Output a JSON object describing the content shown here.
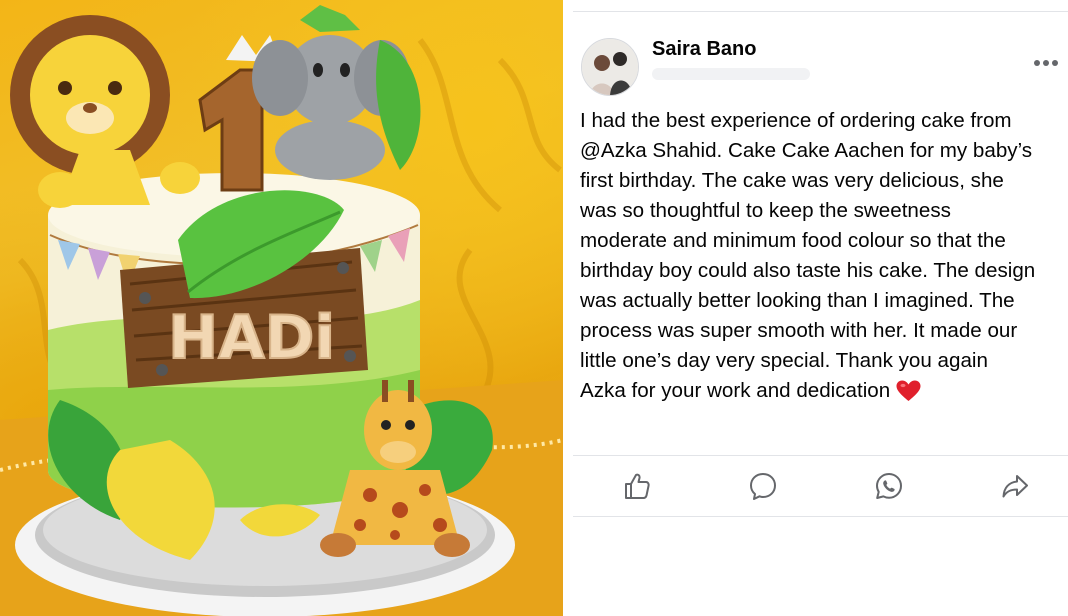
{
  "photo": {
    "description_icon": "cake-photo",
    "cake_name_topper": "HADi",
    "number_topper": "1"
  },
  "post": {
    "author": "Saira Bano",
    "avatar_icon": "profile-avatar",
    "more_icon": "more-options-icon",
    "body_lines": [
      "I had the best experience of ordering cake from",
      "@Azka Shahid. Cake Cake Aachen for my baby’s",
      "first birthday. The cake was very delicious, she",
      "was so thoughtful to keep the sweetness",
      "moderate and minimum food colour so that the",
      "birthday boy could also taste his cake. The design",
      "was actually better looking than I imagined. The",
      "process was super smooth with her. It made our",
      "little one’s day very special. Thank you again",
      "Azka for your work and dedication"
    ],
    "heart_emoji_color": "#e0202c",
    "actions": [
      {
        "name": "like",
        "icon": "thumbs-up-icon"
      },
      {
        "name": "comment",
        "icon": "comment-bubble-icon"
      },
      {
        "name": "whatsapp",
        "icon": "whatsapp-icon"
      },
      {
        "name": "share",
        "icon": "share-arrow-icon"
      }
    ],
    "icon_color": "#65676b",
    "rule_color": "#e2e4e8"
  }
}
